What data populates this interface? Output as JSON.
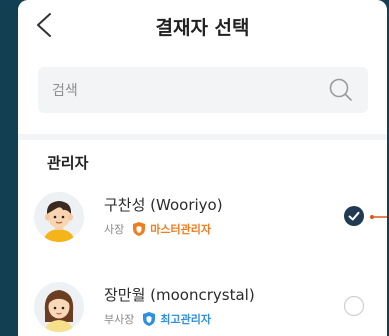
{
  "header": {
    "title": "결재자 선택"
  },
  "search": {
    "placeholder": "검색"
  },
  "section": {
    "title": "관리자"
  },
  "members": [
    {
      "name": "구찬성 (Wooriyo)",
      "role": "사장",
      "badge": "마스터관리자",
      "badge_color": "#f07d1f",
      "selected": true
    },
    {
      "name": "장만월 (mooncrystal)",
      "role": "부사장",
      "badge": "최고관리자",
      "badge_color": "#2f8fe0",
      "selected": false
    }
  ],
  "colors": {
    "check_fill": "#1f3a52",
    "background": "#123f52"
  }
}
